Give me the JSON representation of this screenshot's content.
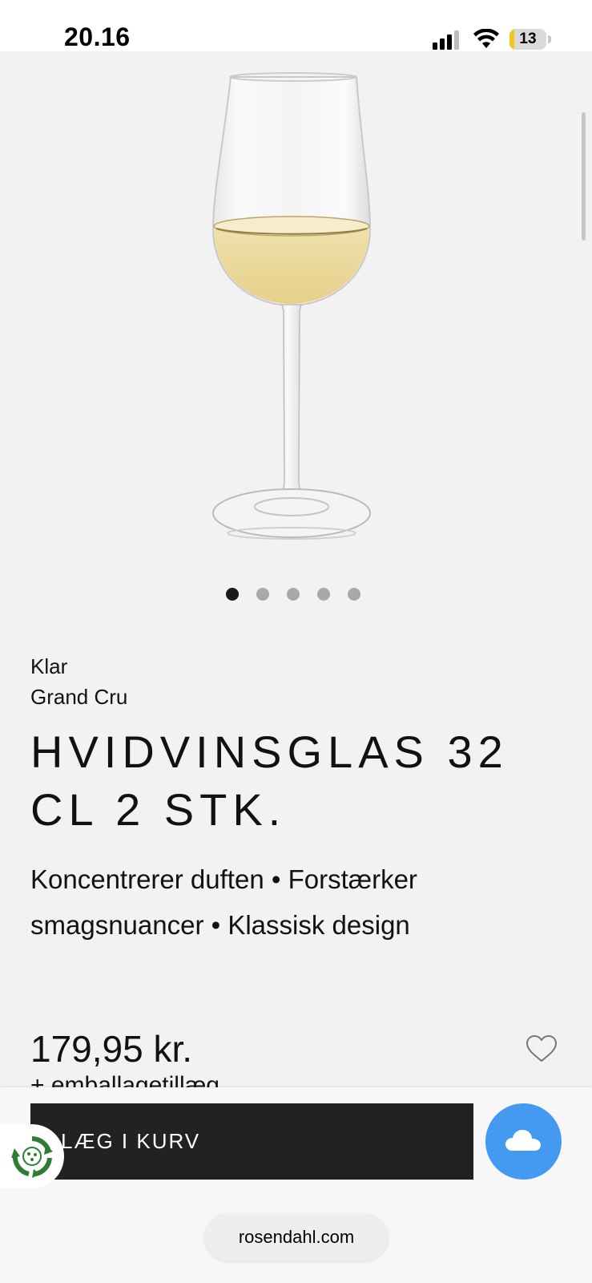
{
  "status_bar": {
    "time": "20.16",
    "battery": "13",
    "battery_level": 0.13,
    "signal_icon": "cellular-signal-icon",
    "wifi_icon": "wifi-icon"
  },
  "product": {
    "image_icon": "wine-glass-image",
    "carousel": {
      "total": 5,
      "active_index": 0
    },
    "variant": "Klar",
    "collection": "Grand Cru",
    "title": "HVIDVINSGLAS 32 CL 2 STK.",
    "features": [
      "Koncentrerer duften",
      "Forstærker smagsnuancer",
      "Klassisk design"
    ],
    "price": "179,95 kr.",
    "packaging_note": "+ emballagetillæg"
  },
  "actions": {
    "add_to_cart_label": "LÆG I KURV",
    "wishlist_icon": "heart-outline-icon",
    "weather_icon": "cloud-icon",
    "eco_icon": "recycle-badge-icon",
    "accent_color": "#4499f1",
    "button_color": "#222222"
  },
  "browser": {
    "url": "rosendahl.com"
  }
}
